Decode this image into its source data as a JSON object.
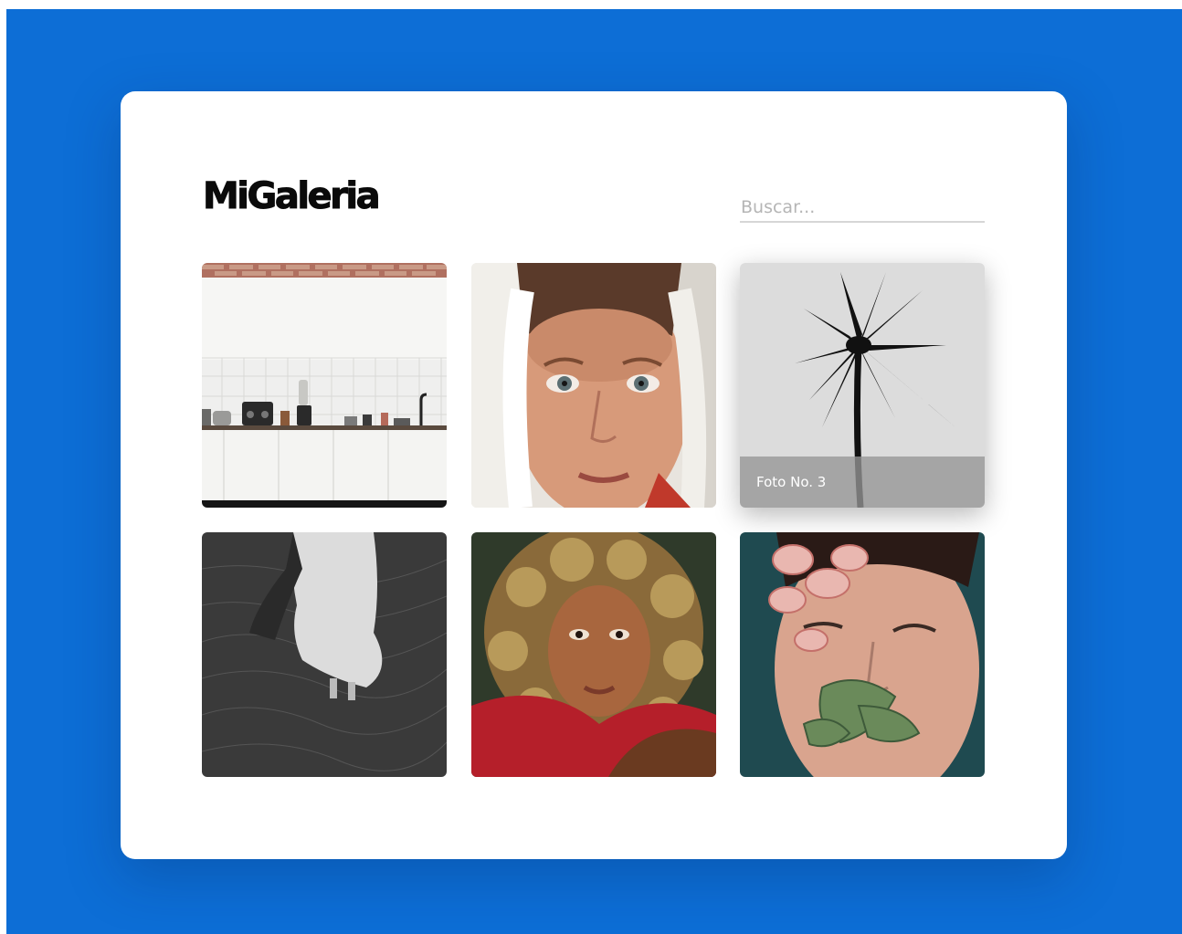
{
  "colors": {
    "background": "#0d6ed6",
    "card": "#ffffff",
    "title": "#0a0a0a",
    "search_underline": "#d6d6d6",
    "caption_overlay": "#969696"
  },
  "header": {
    "title": "MiGaleria"
  },
  "search": {
    "placeholder": "Buscar..."
  },
  "gallery": {
    "photos": [
      {
        "subject": "kitchen counter with white tiles and appliances",
        "caption": ""
      },
      {
        "subject": "portrait of a child wearing a white headscarf",
        "caption": ""
      },
      {
        "subject": "black and white palm tree silhouette",
        "caption": "Foto No. 3"
      },
      {
        "subject": "woman in white dress walking through dark grass",
        "caption": ""
      },
      {
        "subject": "woman with curly hair in red top",
        "caption": ""
      },
      {
        "subject": "woman with flower petals and leaves on face",
        "caption": ""
      }
    ]
  }
}
